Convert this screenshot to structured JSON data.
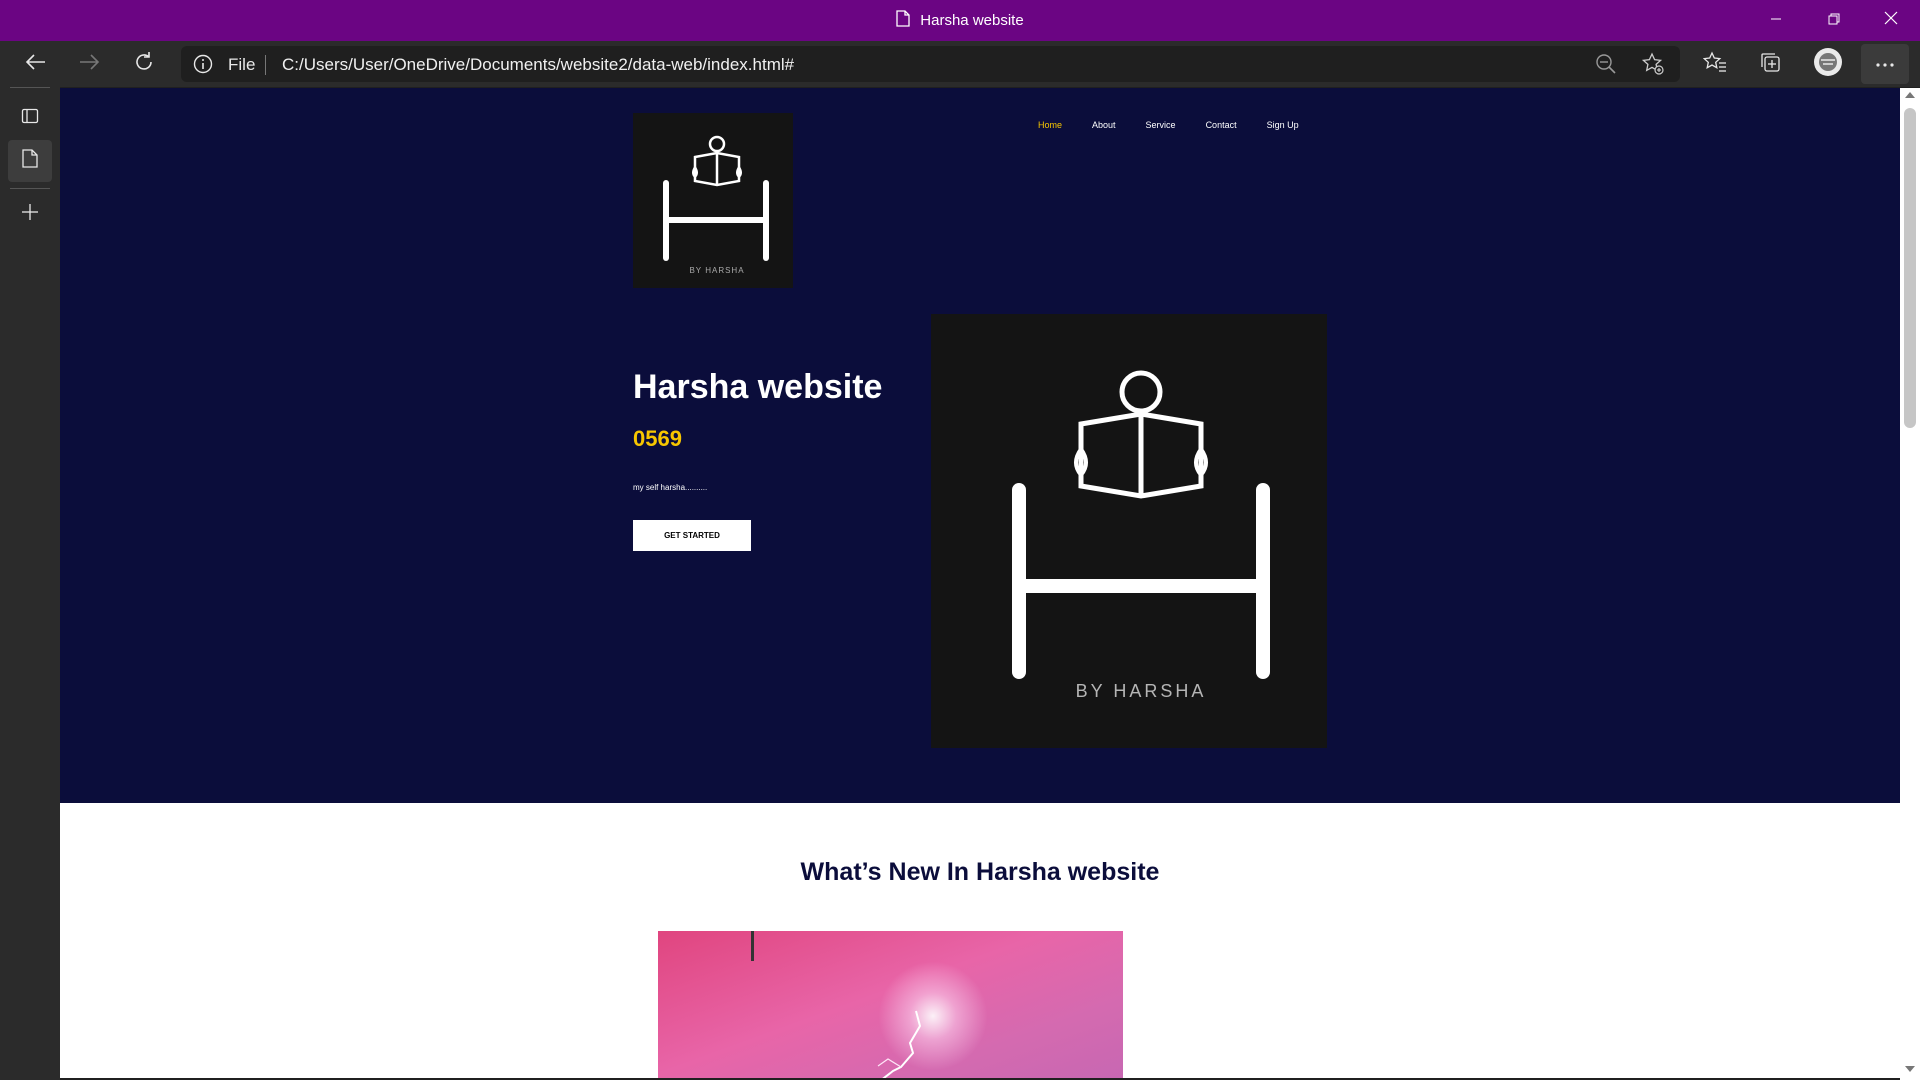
{
  "window": {
    "title": "Harsha website",
    "colors": {
      "titlebar": "#6b0583",
      "toolbar": "#2b2b2b"
    }
  },
  "toolbar": {
    "protocol_label": "File",
    "url": "C:/Users/User/OneDrive/Documents/website2/data-web/index.html#",
    "icons": [
      "back-arrow-icon",
      "forward-arrow-icon",
      "refresh-icon",
      "info-icon",
      "zoom-out-icon",
      "add-favorite-icon",
      "favorites-icon",
      "collections-icon",
      "profile-icon",
      "more-icon"
    ]
  },
  "sidebar": {
    "icons": [
      "tab-actions-icon",
      "page-tab-icon",
      "new-tab-icon"
    ]
  },
  "page": {
    "colors": {
      "hero_bg": "#0b0d3b",
      "accent": "#f7c600",
      "logo_bg": "#141414"
    },
    "nav": {
      "home": "Home",
      "about": "About",
      "service": "Service",
      "contact": "Contact",
      "signup": "Sign Up"
    },
    "logo_text": "BY HARSHA",
    "hero": {
      "title": "Harsha website",
      "subtitle": "0569",
      "description": "my self harsha..........",
      "cta": "GET STARTED"
    },
    "news": {
      "title": "What’s New In Harsha website"
    }
  }
}
